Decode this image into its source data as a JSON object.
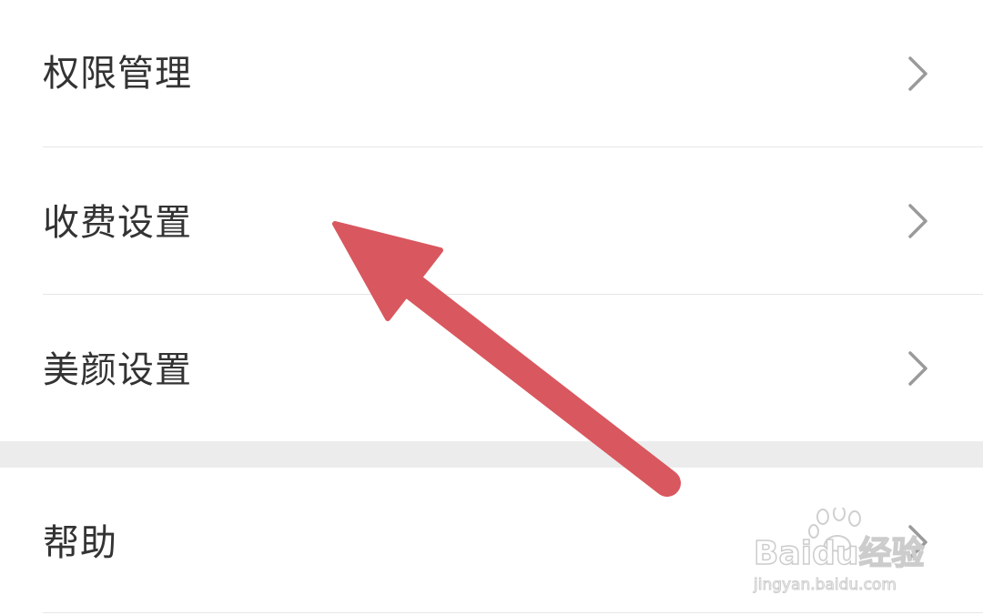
{
  "settings": {
    "items": [
      {
        "label": "权限管理",
        "icon": "chevron-right-icon"
      },
      {
        "label": "收费设置",
        "icon": "chevron-right-icon"
      },
      {
        "label": "美颜设置",
        "icon": "chevron-right-icon"
      },
      {
        "label": "帮助",
        "icon": "chevron-right-icon"
      }
    ]
  },
  "annotation": {
    "arrow_color": "#d9575e",
    "points_to": "收费设置"
  },
  "watermark": {
    "brand_text": "Baidu经验",
    "url_text": "jingyan.baidu.com",
    "icon": "paw-icon"
  },
  "colors": {
    "text": "#333333",
    "chevron": "#9a9a9a",
    "divider": "#e6e6e6",
    "section_gap": "#ececec"
  }
}
